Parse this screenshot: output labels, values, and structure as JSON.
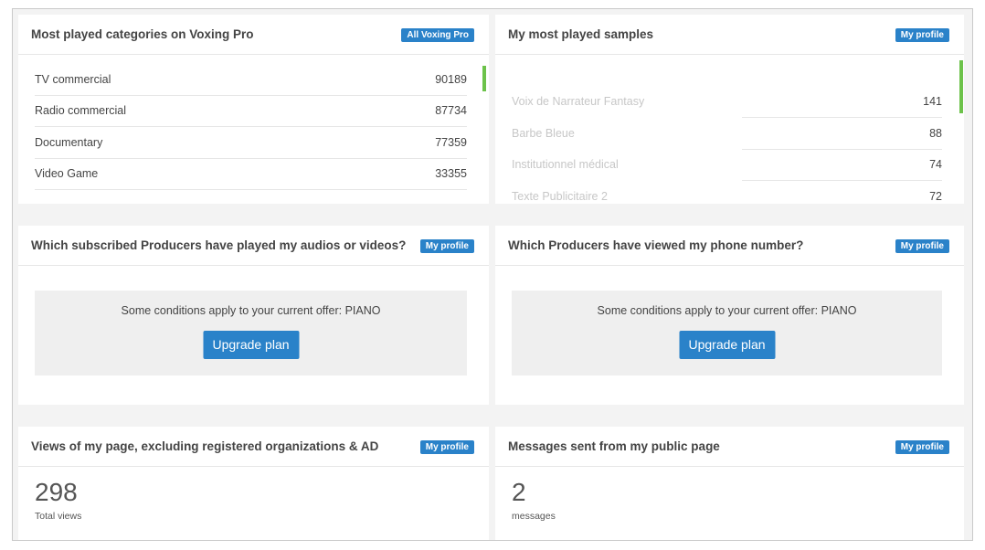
{
  "panels": {
    "categories": {
      "title": "Most played categories on Voxing Pro",
      "badge": "All Voxing Pro",
      "rows": [
        {
          "label": "TV commercial",
          "value": "90189"
        },
        {
          "label": "Radio commercial",
          "value": "87734"
        },
        {
          "label": "Documentary",
          "value": "77359"
        },
        {
          "label": "Video Game",
          "value": "33355"
        }
      ]
    },
    "samples": {
      "title": "My most played samples",
      "badge": "My profile",
      "rows": [
        {
          "label": "Voix de Narrateur Fantasy",
          "value": "141"
        },
        {
          "label": "Barbe Bleue",
          "value": "88"
        },
        {
          "label": "Institutionnel médical",
          "value": "74"
        },
        {
          "label": "Texte Publicitaire 2",
          "value": "72"
        }
      ]
    },
    "producers_played": {
      "title": "Which subscribed Producers have played my audios or videos?",
      "badge": "My profile",
      "message": "Some conditions apply to your current offer: PIANO",
      "button": "Upgrade plan"
    },
    "producers_phone": {
      "title": "Which Producers have viewed my phone number?",
      "badge": "My profile",
      "message": "Some conditions apply to your current offer: PIANO",
      "button": "Upgrade plan"
    },
    "views": {
      "title": "Views of my page, excluding registered organizations & AD",
      "badge": "My profile",
      "number": "298",
      "caption": "Total views"
    },
    "messages": {
      "title": "Messages sent from my public page",
      "badge": "My profile",
      "number": "2",
      "caption": "messages"
    }
  },
  "colors": {
    "accent": "#2a82c9",
    "scroll_indicator": "#6cc24a"
  }
}
